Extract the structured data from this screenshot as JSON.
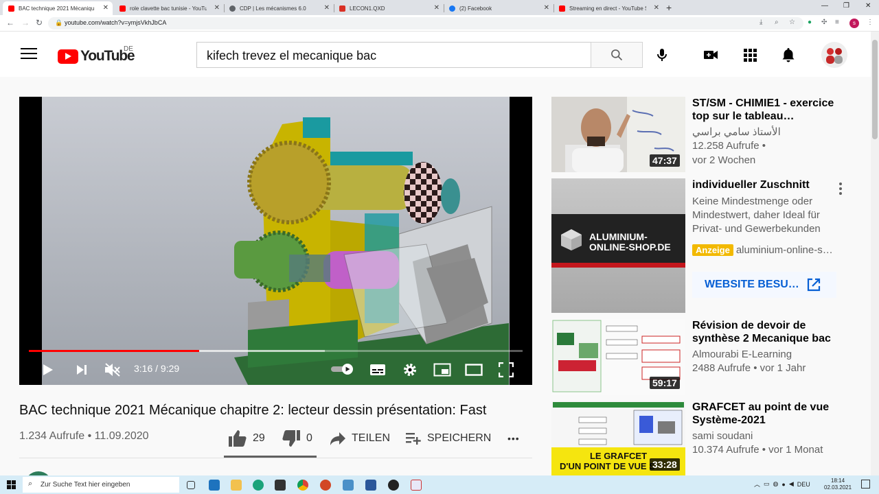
{
  "browser": {
    "tabs": [
      {
        "title": "BAC technique 2021 Mécaniqu",
        "favicon_color": "#ff0000",
        "active": true
      },
      {
        "title": "role clavette bac tunisie - YouTub",
        "favicon_color": "#ff0000",
        "active": false
      },
      {
        "title": "CDP | Les mécanismes 6.0",
        "favicon_color": "#5f6368",
        "active": false
      },
      {
        "title": "LECON1.QXD",
        "favicon_color": "#d93025",
        "active": false
      },
      {
        "title": "(2) Facebook",
        "favicon_color": "#1877f2",
        "active": false
      },
      {
        "title": "Streaming en direct - YouTube St",
        "favicon_color": "#ff0000",
        "active": false
      }
    ],
    "new_tab": "+",
    "window_controls": [
      "—",
      "❐",
      "✕"
    ],
    "url": "youtube.com/watch?v=ymjsVkhJbCA",
    "profile_initial": "s"
  },
  "youtube": {
    "logo_text": "YouTube",
    "country_code": "DE",
    "search_query": "kifech trevez el mecanique bac"
  },
  "player": {
    "current_time": "3:16",
    "duration": "9:29",
    "time_display": "3:16 / 9:29",
    "progress_fraction": 0.345,
    "buffered_fraction": 0.6
  },
  "video": {
    "title": "BAC technique 2021 Mécanique chapitre 2: lecteur dessin présentation: Fast",
    "views_date": "1.234 Aufrufe • 11.09.2020",
    "likes": "29",
    "dislikes": "0",
    "like_ratio": 1.0,
    "share_label": "TEILEN",
    "save_label": "SPEICHERN",
    "more_label": "•••"
  },
  "suggestions": [
    {
      "title": "ST/SM - CHIMIE1 - exercice top sur le tableau…",
      "channel": "الأستاذ سامي براسي",
      "line1": "12.258 Aufrufe •",
      "line2": "vor 2 Wochen",
      "duration": "47:37"
    },
    {
      "title": "Révision de devoir de synthèse 2 Mecanique bac",
      "channel": "Almourabi E-Learning",
      "line1": "2488 Aufrufe • vor 1 Jahr",
      "duration": "59:17"
    },
    {
      "title": "GRAFCET au point de vue Système-2021",
      "channel": "sami soudani",
      "line1": "10.374 Aufrufe • vor 1 Monat",
      "duration": "33:28",
      "thumb_caption_1": "LE GRAFCET",
      "thumb_caption_2": "D'UN POINT DE VUE S"
    }
  ],
  "ad": {
    "title": "individueller Zuschnitt",
    "description": "Keine Mindestmenge oder Mindestwert, daher Ideal für Privat- und Gewerbekunden",
    "badge": "Anzeige",
    "domain": "aluminium-online-s…",
    "button": "WEBSITE BESU…",
    "thumb_line1": "ALUMINIUM-",
    "thumb_line2": "ONLINE-SHOP.DE"
  },
  "taskbar": {
    "search_placeholder": "Zur Suche Text hier eingeben",
    "lang": "DEU",
    "time": "18:14",
    "date": "02.03.2021"
  }
}
